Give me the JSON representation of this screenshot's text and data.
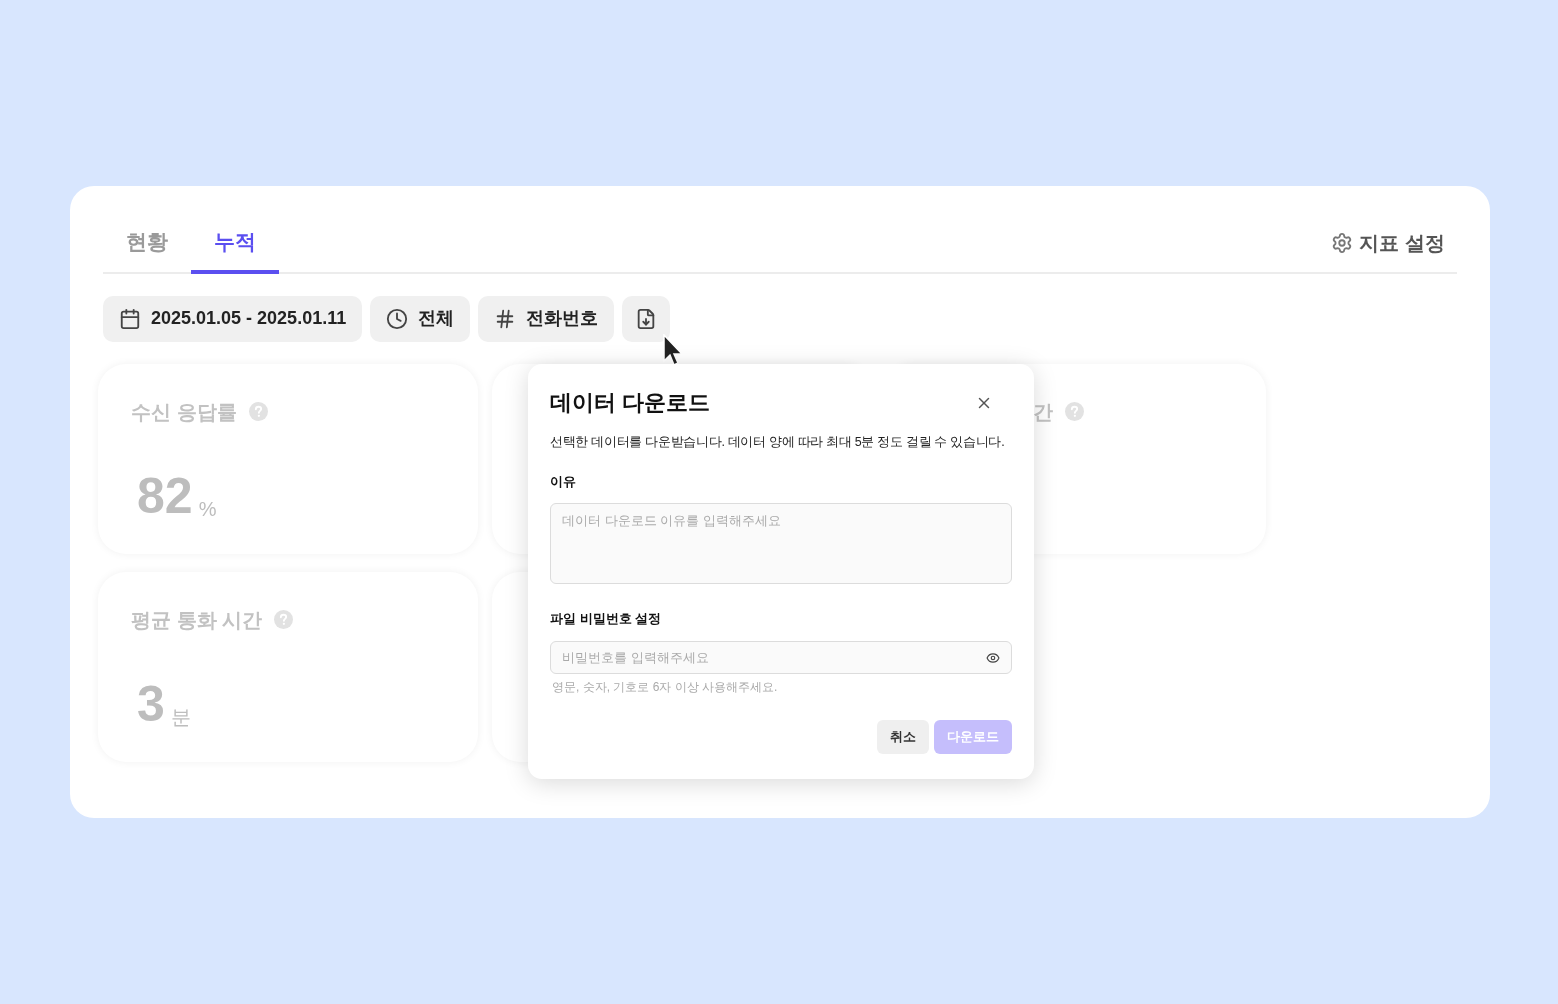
{
  "tabs": [
    {
      "label": "현황",
      "selected": false
    },
    {
      "label": "누적",
      "selected": true
    }
  ],
  "settings_button": {
    "label": "지표 설정"
  },
  "filters": [
    {
      "kind": "date",
      "label": "2025.01.05 - 2025.01.11"
    },
    {
      "kind": "time",
      "label": "전체"
    },
    {
      "kind": "hash",
      "label": "전화번호"
    },
    {
      "kind": "download"
    }
  ],
  "metric_rows": [
    [
      {
        "kind": "full",
        "title": "수신 응답률",
        "value": "82",
        "unit": "%"
      },
      {
        "kind": "covered"
      },
      {
        "kind": "covered",
        "title": "간"
      }
    ],
    [
      {
        "kind": "full",
        "title": "평균 통화 시간",
        "value": "3",
        "unit": "분"
      },
      {
        "kind": "covered"
      }
    ]
  ],
  "dialog": {
    "title": "데이터 다운로드",
    "description": "선택한 데이터를 다운받습니다. 데이터 양에 따라 최대 5분 정도 걸릴 수 있습니다.",
    "reason": {
      "label": "이유",
      "placeholder": "데이터 다운로드 이유를 입력해주세요"
    },
    "password": {
      "label": "파일 비밀번호 설정",
      "placeholder": "비밀번호를 입력해주세요",
      "hint": "영문, 숫자, 기호로 6자 이상 사용해주세요."
    },
    "buttons": [
      {
        "kind": "cancel",
        "label": "취소",
        "disabled": false
      },
      {
        "kind": "primary",
        "label": "다운로드",
        "disabled": true
      }
    ]
  }
}
